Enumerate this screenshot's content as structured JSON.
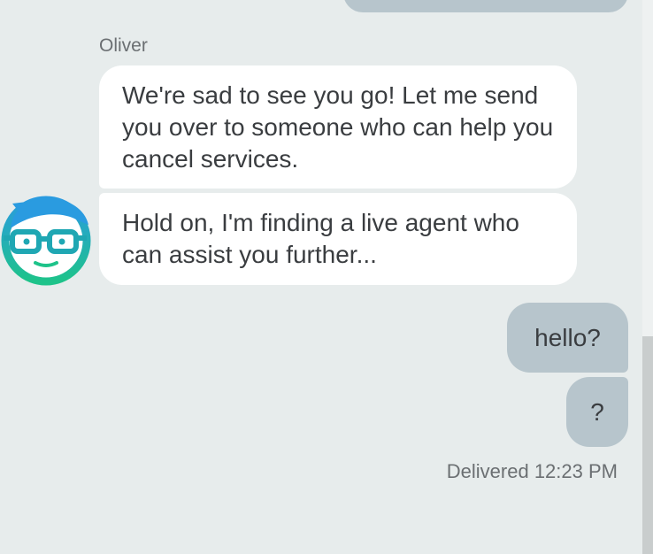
{
  "conversation": {
    "agent": {
      "name": "Oliver",
      "avatar_icon": "bot-face-with-glasses-icon",
      "messages": [
        "We're sad to see you go! Let me send you over to someone who can help you cancel services.",
        "Hold on, I'm finding a live agent who can assist you further..."
      ]
    },
    "user": {
      "messages": [
        "hello?",
        "?"
      ]
    },
    "status": "Delivered 12:23 PM"
  },
  "colors": {
    "background": "#e7ecec",
    "agent_bubble": "#ffffff",
    "user_bubble": "#b7c5cc",
    "text": "#3a3d40",
    "muted_text": "#6b6f72",
    "avatar_teal": "#1eb39a",
    "avatar_blue": "#2a9be0"
  }
}
